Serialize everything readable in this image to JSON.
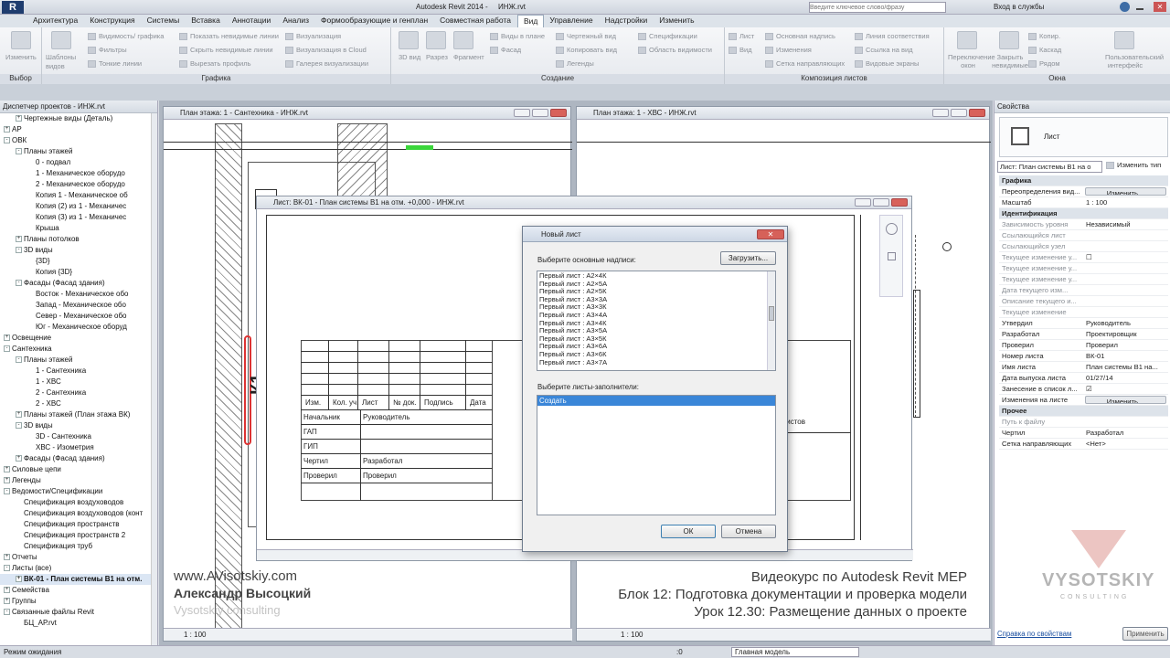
{
  "titlebar": {
    "app": "Autodesk Revit 2014 -",
    "file": "ИНЖ.rvt",
    "search_placeholder": "Введите ключевое слово/фразу",
    "login": "Вход в службы"
  },
  "ribbon_tabs": [
    "Архитектура",
    "Конструкция",
    "Системы",
    "Вставка",
    "Аннотации",
    "Анализ",
    "Формообразующие и генплан",
    "Совместная работа",
    "Вид",
    "Управление",
    "Надстройки",
    "Изменить"
  ],
  "active_tab": "Вид",
  "ribbon": {
    "modify": "Изменить",
    "select": "Выбор",
    "templates": "Шаблоны видов",
    "graphics_items": [
      "Видимость/ графика",
      "Фильтры",
      "Тонкие линии",
      "Показать невидимые линии",
      "Скрыть невидимые линии",
      "Вырезать профиль",
      "Визуализация",
      "Визуализация в Cloud",
      "Галерея визуализации"
    ],
    "graphics_label": "Графика",
    "create_big": [
      "3D вид",
      "Разрез",
      "Фрагмент"
    ],
    "create_items": [
      "Виды в плане",
      "Фасад",
      "Чертежный вид",
      "Копировать вид",
      "Легенды",
      "Спецификации",
      "Область видимости"
    ],
    "create_label": "Создание",
    "sheet_items": [
      "Лист",
      "Вид",
      "Основная надпись",
      "Изменения",
      "Сетка направляющих",
      "Линия соответствия",
      "Ссылка на вид",
      "Видовые экраны"
    ],
    "sheet_label": "Композиция листов",
    "window_items": [
      "Переключение окон",
      "Закрыть невидимые",
      "Копир.",
      "Каскад",
      "Рядом",
      "Пользовательский интерфейс"
    ],
    "window_label": "Окна"
  },
  "project_browser": {
    "title": "Диспетчер проектов - ИНЖ.rvt",
    "items": [
      {
        "t": "Чертежные виды (Деталь)",
        "lvl": 1,
        "g": "+"
      },
      {
        "t": "АР",
        "lvl": 0,
        "g": "+"
      },
      {
        "t": "ОВК",
        "lvl": 0,
        "g": "-"
      },
      {
        "t": "Планы этажей",
        "lvl": 1,
        "g": "-"
      },
      {
        "t": "0 - подвал",
        "lvl": 2,
        "g": ""
      },
      {
        "t": "1 - Механическое оборудо",
        "lvl": 2,
        "g": ""
      },
      {
        "t": "2 - Механическое оборудо",
        "lvl": 2,
        "g": ""
      },
      {
        "t": "Копия 1 - Механическое об",
        "lvl": 2,
        "g": ""
      },
      {
        "t": "Копия (2) из 1 - Механичес",
        "lvl": 2,
        "g": ""
      },
      {
        "t": "Копия (3) из 1 - Механичес",
        "lvl": 2,
        "g": ""
      },
      {
        "t": "Крыша",
        "lvl": 2,
        "g": ""
      },
      {
        "t": "Планы потолков",
        "lvl": 1,
        "g": "+"
      },
      {
        "t": "3D виды",
        "lvl": 1,
        "g": "-"
      },
      {
        "t": "{3D}",
        "lvl": 2,
        "g": ""
      },
      {
        "t": "Копия {3D}",
        "lvl": 2,
        "g": ""
      },
      {
        "t": "Фасады (Фасад здания)",
        "lvl": 1,
        "g": "-"
      },
      {
        "t": "Восток - Механическое обо",
        "lvl": 2,
        "g": ""
      },
      {
        "t": "Запад - Механическое обо",
        "lvl": 2,
        "g": ""
      },
      {
        "t": "Север - Механическое обо",
        "lvl": 2,
        "g": ""
      },
      {
        "t": "Юг - Механическое оборуд",
        "lvl": 2,
        "g": ""
      },
      {
        "t": "Освещение",
        "lvl": 0,
        "g": "+"
      },
      {
        "t": "Сантехника",
        "lvl": 0,
        "g": "-"
      },
      {
        "t": "Планы этажей",
        "lvl": 1,
        "g": "-"
      },
      {
        "t": "1 - Сантехника",
        "lvl": 2,
        "g": ""
      },
      {
        "t": "1 - ХВС",
        "lvl": 2,
        "g": ""
      },
      {
        "t": "2 - Сантехника",
        "lvl": 2,
        "g": ""
      },
      {
        "t": "2 - ХВС",
        "lvl": 2,
        "g": ""
      },
      {
        "t": "Планы этажей (План этажа ВК)",
        "lvl": 1,
        "g": "+"
      },
      {
        "t": "3D виды",
        "lvl": 1,
        "g": "-"
      },
      {
        "t": "3D - Сантехника",
        "lvl": 2,
        "g": ""
      },
      {
        "t": "ХВС - Изометрия",
        "lvl": 2,
        "g": ""
      },
      {
        "t": "Фасады (Фасад здания)",
        "lvl": 1,
        "g": "+"
      },
      {
        "t": "Силовые цепи",
        "lvl": 0,
        "g": "+"
      },
      {
        "t": "Легенды",
        "lvl": 0,
        "g": "+"
      },
      {
        "t": "Ведомости/Спецификации",
        "lvl": 0,
        "g": "-"
      },
      {
        "t": "Спецификация воздуховодов",
        "lvl": 1,
        "g": ""
      },
      {
        "t": "Спецификация воздуховодов (конт",
        "lvl": 1,
        "g": ""
      },
      {
        "t": "Спецификация пространств",
        "lvl": 1,
        "g": ""
      },
      {
        "t": "Спецификация пространств 2",
        "lvl": 1,
        "g": ""
      },
      {
        "t": "Спецификация труб",
        "lvl": 1,
        "g": ""
      },
      {
        "t": "Отчеты",
        "lvl": 0,
        "g": "+"
      },
      {
        "t": "Листы (все)",
        "lvl": 0,
        "g": "-"
      },
      {
        "t": "ВК-01 - План системы В1 на отм.",
        "lvl": 1,
        "g": "+",
        "sel": true
      },
      {
        "t": "Семейства",
        "lvl": 0,
        "g": "+"
      },
      {
        "t": "Группы",
        "lvl": 0,
        "g": "+"
      },
      {
        "t": "Связанные файлы Revit",
        "lvl": 0,
        "g": "-"
      },
      {
        "t": "БЦ_АР.rvt",
        "lvl": 1,
        "g": ""
      }
    ]
  },
  "views": {
    "left_title": "План этажа: 1 - Сантехника - ИНЖ.rvt",
    "right_title": "План этажа: 1 - ХВС - ИНЖ.rvt",
    "sheet_title": "Лист: ВК-01 - План системы В1 на отм. +0,000 - ИНЖ.rvt",
    "scale_left": "1 : 100",
    "scale_right": "1 : 100",
    "label_k1": "К1"
  },
  "title_block": {
    "headers": [
      "Изм.",
      "Кол. уч.",
      "Лист",
      "№ док.",
      "Подпись",
      "Дата"
    ],
    "rows": [
      [
        "Начальник",
        "Руководитель"
      ],
      [
        "ГАП",
        ""
      ],
      [
        "ГИП",
        ""
      ],
      [
        "Чертил",
        "Разработал"
      ],
      [
        "Проверил",
        "Проверил"
      ]
    ],
    "sheets_label": "Листов"
  },
  "dialog": {
    "title": "Новый лист",
    "select_titleblocks": "Выберите основные надписи:",
    "load": "Загрузить...",
    "titleblocks": [
      "Первый лист : А2×4К",
      "Первый лист : А2×5А",
      "Первый лист : А2×5К",
      "Первый лист : А3×3А",
      "Первый лист : А3×3К",
      "Первый лист : А3×4А",
      "Первый лист : А3×4К",
      "Первый лист : А3×5А",
      "Первый лист : А3×5К",
      "Первый лист : А3×6А",
      "Первый лист : А3×6К",
      "Первый лист : А3×7А"
    ],
    "select_placeholders": "Выберите листы-заполнители:",
    "placeholders": [
      "Создать"
    ],
    "ok": "ОК",
    "cancel": "Отмена"
  },
  "properties": {
    "title": "Свойства",
    "type": "Лист",
    "selector": "Лист: План системы В1 на о",
    "edit_type": "Изменить тип",
    "rows": [
      {
        "k": "Графика",
        "v": "",
        "sec": true
      },
      {
        "k": "Переопределения вид...",
        "v": "Изменить...",
        "btn": true
      },
      {
        "k": "Масштаб",
        "v": "1 : 100"
      },
      {
        "k": "Идентификация",
        "v": "",
        "sec": true
      },
      {
        "k": "Зависимость уровня",
        "v": "Независимый",
        "grey": true
      },
      {
        "k": "Ссылающийся лист",
        "v": "",
        "grey": true
      },
      {
        "k": "Ссылающийся узел",
        "v": "",
        "grey": true
      },
      {
        "k": "Текущее изменение у...",
        "v": "☐",
        "grey": true
      },
      {
        "k": "Текущее изменение у...",
        "v": "",
        "grey": true
      },
      {
        "k": "Текущее изменение у...",
        "v": "",
        "grey": true
      },
      {
        "k": "Дата текущего изм...",
        "v": "",
        "grey": true
      },
      {
        "k": "Описание текущего и...",
        "v": "",
        "grey": true
      },
      {
        "k": "Текущее изменение",
        "v": "",
        "grey": true
      },
      {
        "k": "Утвердил",
        "v": "Руководитель"
      },
      {
        "k": "Разработал",
        "v": "Проектировщик"
      },
      {
        "k": "Проверил",
        "v": "Проверил"
      },
      {
        "k": "Номер листа",
        "v": "ВК-01"
      },
      {
        "k": "Имя листа",
        "v": "План системы В1 на..."
      },
      {
        "k": "Дата выпуска листа",
        "v": "01/27/14"
      },
      {
        "k": "Занесение в список л...",
        "v": "☑"
      },
      {
        "k": "Изменения на листе",
        "v": "Изменить...",
        "btn": true
      },
      {
        "k": "Прочее",
        "v": "",
        "sec": true
      },
      {
        "k": "Путь к файлу",
        "v": "",
        "grey": true
      },
      {
        "k": "Чертил",
        "v": "Разработал"
      },
      {
        "k": "Сетка направляющих",
        "v": "<Нет>"
      }
    ],
    "help": "Справка по свойствам",
    "apply": "Применить"
  },
  "statusbar": {
    "text": "Режим ожидания",
    "zero": ":0",
    "model": "Главная модель"
  },
  "overlay": {
    "site": "www.AVisotskiy.com",
    "author": "Александр Высоцкий",
    "consult": "Vysotskiy consulting",
    "course": "Видеокурс по Autodesk Revit MEP",
    "block": "Блок 12: Подготовка документации и проверка модели",
    "lesson": "Урок 12.30: Размещение данных о проекте",
    "logo": "VYSOTSKIY",
    "logo_sub": "CONSULTING"
  }
}
